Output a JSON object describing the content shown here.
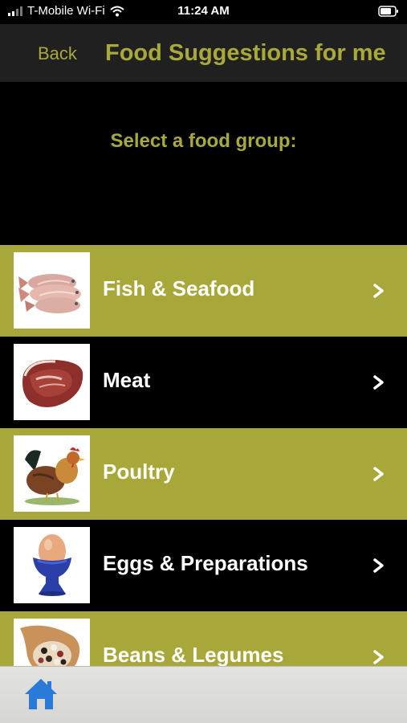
{
  "status_bar": {
    "carrier": "T-Mobile Wi-Fi",
    "time": "11:24 AM"
  },
  "nav": {
    "back_label": "Back",
    "title": "Food Suggestions for me"
  },
  "prompt": "Select a food group:",
  "food_groups": [
    {
      "label": "Fish & Seafood",
      "icon": "fish-image"
    },
    {
      "label": "Meat",
      "icon": "meat-image"
    },
    {
      "label": "Poultry",
      "icon": "rooster-image"
    },
    {
      "label": "Eggs & Preparations",
      "icon": "egg-cup-image"
    },
    {
      "label": "Beans & Legumes",
      "icon": "beans-image"
    }
  ],
  "tab_bar": {
    "home_icon": "home-icon"
  },
  "colors": {
    "accent": "#a9a93a",
    "row_olive": "#a8a83a",
    "row_dark": "#000000",
    "home_blue": "#2a7bd8"
  }
}
